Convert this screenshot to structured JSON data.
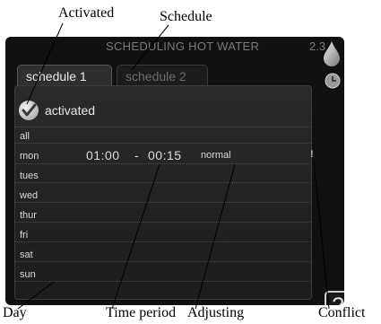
{
  "callouts": {
    "activated": "Activated",
    "schedule": "Schedule",
    "day": "Day",
    "time_period": "Time period",
    "adjusting": "Adjusting",
    "conflict": "Conflict"
  },
  "screen": {
    "title": "SCHEDULING HOT WATER",
    "menu_number": "2.3",
    "tabs": [
      "schedule 1",
      "schedule 2"
    ],
    "activated_label": "activated",
    "days": [
      "all",
      "mon",
      "tues",
      "wed",
      "thur",
      "fri",
      "sat",
      "sun"
    ],
    "entry": {
      "start": "01:00",
      "separator": "-",
      "end": "00:15",
      "adjusting": "normal"
    },
    "conflict_mark": "!",
    "help_symbol": "?"
  },
  "icons": [
    "water-drop-icon",
    "clock-icon",
    "checkmark-icon",
    "help-icon"
  ]
}
